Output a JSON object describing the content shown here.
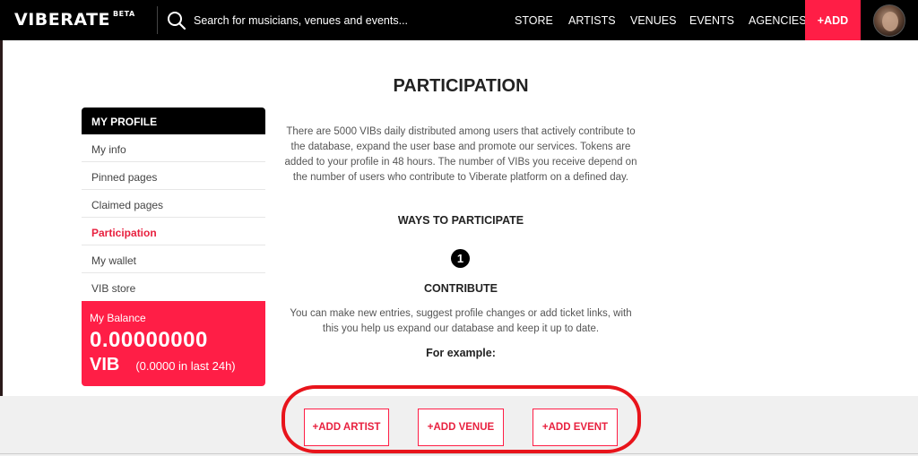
{
  "header": {
    "logo": "VIBERATE",
    "logo_badge": "BETA",
    "search_placeholder": "Search for musicians, venues and events...",
    "nav": [
      "STORE",
      "ARTISTS",
      "VENUES",
      "EVENTS",
      "AGENCIES"
    ],
    "add_label": "+ADD"
  },
  "sidebar": {
    "heading": "MY PROFILE",
    "items": [
      {
        "label": "My info"
      },
      {
        "label": "Pinned pages"
      },
      {
        "label": "Claimed pages"
      },
      {
        "label": "Participation"
      },
      {
        "label": "My wallet"
      },
      {
        "label": "VIB store"
      }
    ],
    "active_index": 3,
    "balance": {
      "label": "My Balance",
      "amount": "0.00000000",
      "unit": "VIB",
      "change": "(0.0000 in last 24h)"
    }
  },
  "main": {
    "title": "PARTICIPATION",
    "intro": "There are 5000 VIBs daily distributed among users that actively contribute to the database, expand the user base and promote our services. Tokens are added to your profile in 48 hours. The number of VIBs you receive depend on the number of users who contribute to Viberate platform on a defined day.",
    "ways_heading": "WAYS TO PARTICIPATE",
    "step_number": "1",
    "step_title": "CONTRIBUTE",
    "step_text": "You can make new entries, suggest profile changes or add ticket links, with this you help us expand our database and keep it up to date.",
    "example_label": "For example:",
    "buttons": {
      "add_artist": "+ADD ARTIST",
      "add_venue": "+ADD VENUE",
      "add_event": "+ADD EVENT"
    }
  },
  "colors": {
    "accent": "#ff1e46",
    "header_bg": "#000000",
    "annotation": "#e8141b"
  }
}
